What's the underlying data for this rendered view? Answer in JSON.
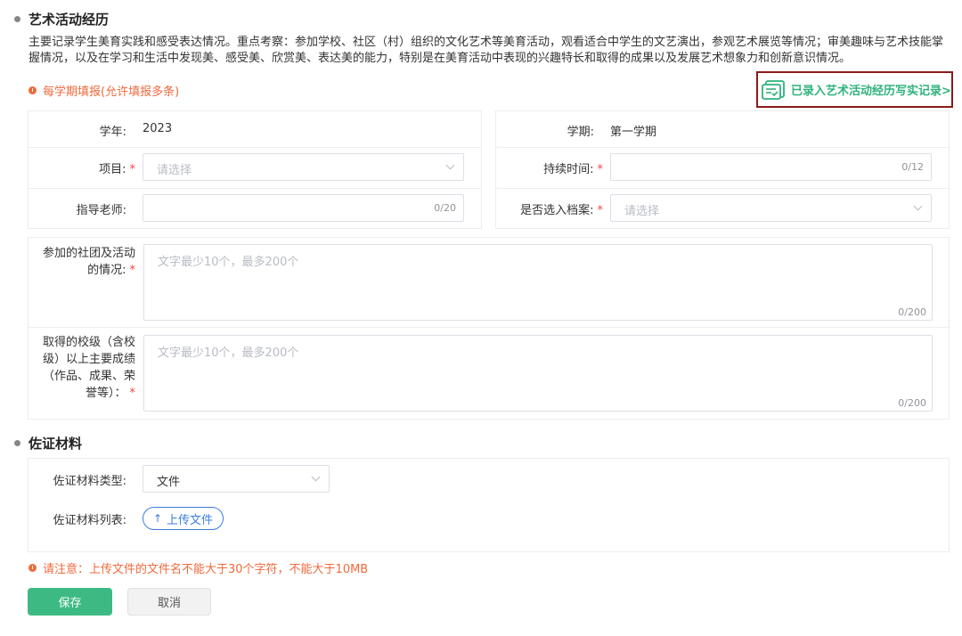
{
  "section1": {
    "title": "艺术活动经历",
    "description": "主要记录学生美育实践和感受表达情况。重点考察：参加学校、社区（村）组织的文化艺术等美育活动，观看适合中学生的文艺演出，参观艺术展览等情况；审美趣味与艺术技能掌握情况，以及在学习和生活中发现美、感受美、欣赏美、表达美的能力，特别是在美育活动中表现的兴趣特长和取得的成果以及发展艺术想象力和创新意识情况。",
    "note": "每学期填报(允许填报多条)",
    "record_link": "已录入艺术活动经历写实记录>"
  },
  "form": {
    "year_label": "学年:",
    "year_value": "2023",
    "term_label": "学期:",
    "term_value": "第一学期",
    "project_label": "项目:",
    "project_placeholder": "请选择",
    "duration_label": "持续时间:",
    "duration_counter": "0/12",
    "teacher_label": "指导老师:",
    "teacher_counter": "0/20",
    "archive_label": "是否选入档案:",
    "archive_placeholder": "请选择",
    "clubs_label": "参加的社团及活动的情况:",
    "clubs_label_line1": "参加的社团及活动",
    "clubs_label_line2": "的情况:",
    "clubs_placeholder": "文字最少10个，最多200个",
    "clubs_counter": "0/200",
    "achievements_label_line1": "取得的校级（含校",
    "achievements_label_line2": "级）以上主要成绩",
    "achievements_label_line3": "（作品、成果、荣",
    "achievements_label_line4": "誉等）：",
    "achievements_placeholder": "文字最少10个，最多200个",
    "achievements_counter": "0/200",
    "required_mark": "*"
  },
  "section2": {
    "title": "佐证材料",
    "type_label": "佐证材料类型:",
    "type_value": "文件",
    "list_label": "佐证材料列表:",
    "upload_label": "上传文件",
    "note": "请注意：上传文件的文件名不能大于30个字符，不能大于10MB"
  },
  "actions": {
    "save": "保存",
    "cancel": "取消"
  },
  "colors": {
    "accent_green": "#3dba84",
    "link_green": "#2fb37b",
    "warning_orange": "#f06a3c",
    "required_red": "#f04848",
    "upload_blue": "#3b7de0",
    "highlight_border": "#8b1a1a"
  },
  "icons": {
    "record": "document-list-icon",
    "upload": "upload-arrow-icon",
    "warning": "warning-circle-icon"
  }
}
